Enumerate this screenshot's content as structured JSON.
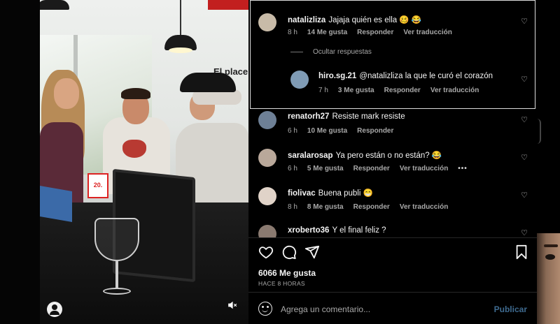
{
  "comments": [
    {
      "user": "natalizliza",
      "text": "Jajaja quién es ella 🥴 😂",
      "time": "8 h",
      "likes": "14 Me gusta",
      "reply": "Responder",
      "translate": "Ver traducción",
      "avatar_color": "#c8bba8"
    },
    {
      "user": "hiro.sg.21",
      "text": "@natalizliza la que le curó el corazón",
      "time": "7 h",
      "likes": "3 Me gusta",
      "reply": "Responder",
      "translate": "Ver traducción",
      "avatar_color": "#7f9bb5"
    },
    {
      "user": "renatorh27",
      "text": "Resiste mark resiste",
      "time": "6 h",
      "likes": "10 Me gusta",
      "reply": "Responder",
      "avatar_color": "#6e8096"
    },
    {
      "user": "saralarosap",
      "text": "Ya pero están o no están? 😂",
      "time": "6 h",
      "likes": "5 Me gusta",
      "reply": "Responder",
      "translate": "Ver traducción",
      "avatar_color": "#b9a89a"
    },
    {
      "user": "fiolivac",
      "text": "Buena publi 😁",
      "time": "8 h",
      "likes": "8 Me gusta",
      "reply": "Responder",
      "translate": "Ver traducción",
      "avatar_color": "#e0d3c8"
    },
    {
      "user": "xroberto36",
      "text": "Y el final feliz ?",
      "avatar_color": "#8a7a70"
    }
  ],
  "hide_replies": "Ocultar respuestas",
  "likes_total": "6066 Me gusta",
  "time_ago": "HACE 8 HORAS",
  "comment_box": {
    "placeholder": "Agrega un comentario...",
    "post_label": "Publicar"
  },
  "video_overlay": {
    "wall_sign": "El placer\nacc",
    "price_tag": "20."
  },
  "colors": {
    "background": "#000000",
    "text": "#f5f5f5",
    "secondary_text": "#a8a8a8",
    "post_button": "#3e6a8f"
  },
  "icons": [
    "heart-icon",
    "comment-icon",
    "share-icon",
    "bookmark-icon",
    "emoji-icon",
    "profile-icon",
    "mute-icon"
  ]
}
